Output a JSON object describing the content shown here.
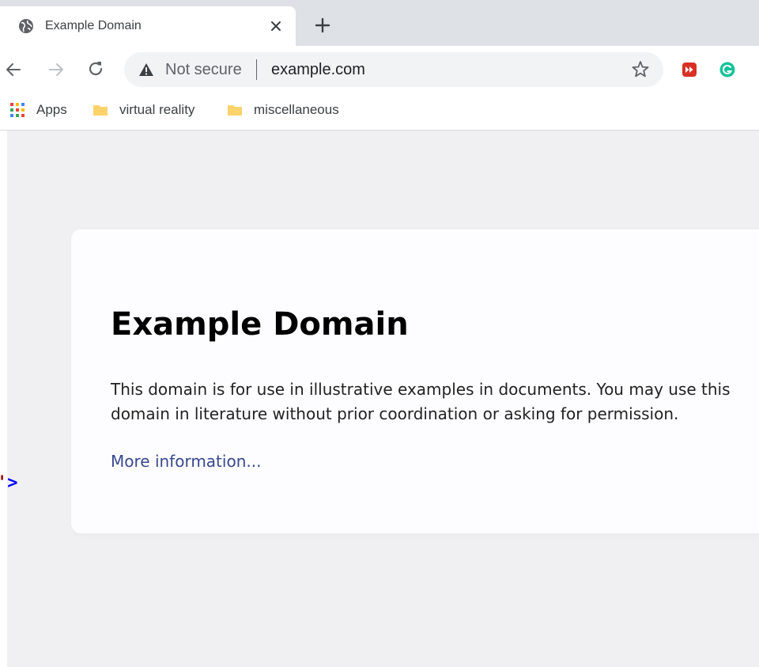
{
  "tab": {
    "title": "Example Domain"
  },
  "toolbar": {
    "security_label": "Not secure",
    "url": "example.com"
  },
  "bookmarks": [
    {
      "label": "Apps",
      "icon": "apps-grid-icon"
    },
    {
      "label": "virtual reality",
      "icon": "folder-icon"
    },
    {
      "label": "miscellaneous",
      "icon": "folder-icon"
    }
  ],
  "page": {
    "heading": "Example Domain",
    "paragraph": "This domain is for use in illustrative examples in documents. You may use this domain in literature without prior coordination or asking for permission.",
    "link_text": "More information..."
  },
  "code_fragment": {
    "quote": "'",
    "bracket": ">"
  },
  "colors": {
    "tabstrip": "#dee1e6",
    "omnibox": "#f1f3f4",
    "page_background": "#f0f0f2",
    "card_background": "#fdfdff",
    "link": "#38488f",
    "folder": "#fcd36b",
    "extension_red": "#d93025",
    "extension_green": "#15c39a"
  }
}
